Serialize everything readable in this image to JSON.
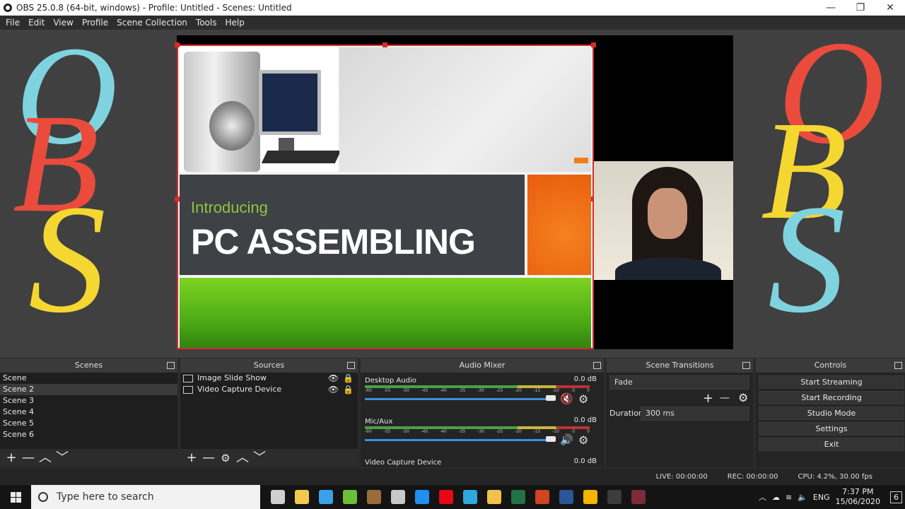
{
  "window": {
    "title": "OBS 25.0.8 (64-bit, windows) - Profile: Untitled - Scenes: Untitled",
    "minimize": "—",
    "maximize": "❐",
    "close": "✕"
  },
  "menu": [
    "File",
    "Edit",
    "View",
    "Profile",
    "Scene Collection",
    "Tools",
    "Help"
  ],
  "decor": {
    "left_letters": [
      "O",
      "B",
      "S"
    ],
    "right_letters": [
      "O",
      "B",
      "S"
    ],
    "colors": {
      "O_left": "#7fd3df",
      "B_left": "#ea4b3c",
      "S_left": "#f5d732",
      "O_right": "#ea4b3c",
      "B_right": "#f5d732",
      "S_right": "#7fd3df"
    }
  },
  "preview": {
    "slide": {
      "intro": "Introducing",
      "heading": "PC ASSEMBLING",
      "intro_color": "#8dc63f",
      "accent_color": "#f07d1c"
    },
    "selection_color": "#d62b2b"
  },
  "scenes": {
    "title": "Scenes",
    "items": [
      "Scene",
      "Scene 2",
      "Scene 3",
      "Scene 4",
      "Scene 5",
      "Scene 6"
    ],
    "selected_index": 1,
    "toolbar": {
      "add": "+",
      "remove": "—",
      "up": "︿",
      "down": "﹀"
    }
  },
  "sources": {
    "title": "Sources",
    "items": [
      {
        "name": "Image Slide Show",
        "icon": "image-icon",
        "visible_icon": "👁",
        "lock_icon": "🔒"
      },
      {
        "name": "Video Capture Device",
        "icon": "camera-icon",
        "visible_icon": "👁",
        "lock_icon": "🔒"
      }
    ],
    "toolbar": {
      "add": "+",
      "remove": "—",
      "settings": "⚙",
      "up": "︿",
      "down": "﹀"
    }
  },
  "mixer": {
    "title": "Audio Mixer",
    "channels": [
      {
        "name": "Desktop Audio",
        "db": "0.0 dB",
        "muted": true
      },
      {
        "name": "Mic/Aux",
        "db": "0.0 dB",
        "muted": false
      },
      {
        "name": "Video Capture Device",
        "db": "0.0 dB",
        "muted": false
      }
    ],
    "ticks": [
      "-60",
      "-55",
      "-50",
      "-45",
      "-40",
      "-35",
      "-30",
      "-25",
      "-20",
      "-15",
      "-10",
      "-5",
      "0"
    ],
    "mute_icon": "🔇",
    "speaker_icon": "🔊",
    "gear_icon": "⚙"
  },
  "transitions": {
    "title": "Scene Transitions",
    "selected": "Fade",
    "duration_label": "Duration",
    "duration_value": "300 ms",
    "add": "+",
    "remove": "—",
    "gear": "⚙"
  },
  "controls": {
    "title": "Controls",
    "buttons": [
      "Start Streaming",
      "Start Recording",
      "Studio Mode",
      "Settings",
      "Exit"
    ]
  },
  "status": {
    "live": "LIVE: 00:00:00",
    "rec": "REC: 00:00:00",
    "cpu": "CPU: 4.2%, 30.00 fps"
  },
  "taskbar": {
    "search_placeholder": "Type here to search",
    "apps": [
      {
        "name": "task-view-icon",
        "color": "#cfcfcf"
      },
      {
        "name": "store-icon",
        "color": "#f2c94c"
      },
      {
        "name": "sendanywhere-icon",
        "color": "#3aa0e8"
      },
      {
        "name": "utorrent-icon",
        "color": "#6dbf3a"
      },
      {
        "name": "winrar-icon",
        "color": "#9b6b3d"
      },
      {
        "name": "cortana-icon",
        "color": "#c8c8c8"
      },
      {
        "name": "sway-icon",
        "color": "#1f8ff0"
      },
      {
        "name": "netflix-icon",
        "color": "#e50914"
      },
      {
        "name": "edge-icon",
        "color": "#2fa8e0"
      },
      {
        "name": "explorer-icon",
        "color": "#f3c14b"
      },
      {
        "name": "excel-icon",
        "color": "#217346"
      },
      {
        "name": "powerpoint-icon",
        "color": "#d04423"
      },
      {
        "name": "word-icon",
        "color": "#2b579a"
      },
      {
        "name": "chrome-icon",
        "color": "#f4b400"
      },
      {
        "name": "obs-icon",
        "color": "#3c3c3c"
      },
      {
        "name": "video-editor-icon",
        "color": "#7d2b3a"
      }
    ],
    "tray_lang": "ENG",
    "time": "7:37 PM",
    "date": "15/06/2020",
    "notifications": "6"
  }
}
